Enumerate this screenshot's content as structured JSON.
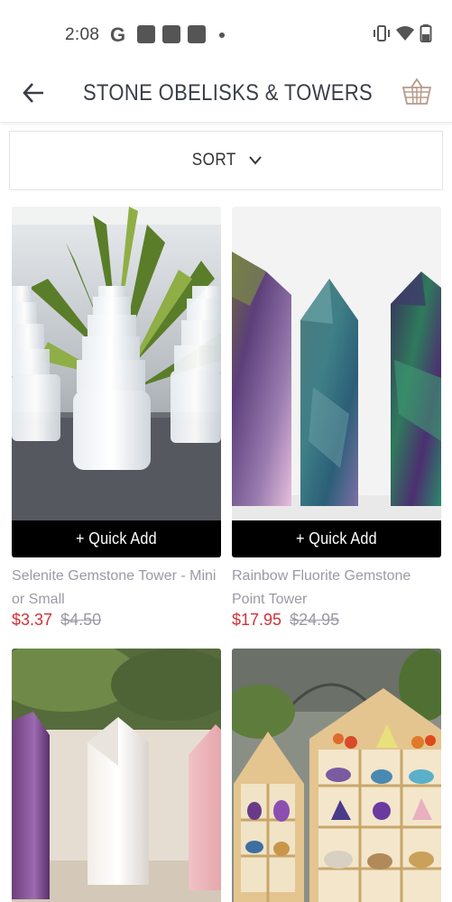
{
  "status_bar": {
    "time": "2:08",
    "g_letter": "G"
  },
  "header": {
    "title": "STONE OBELISKS & TOWERS"
  },
  "sort": {
    "label": "SORT"
  },
  "products": [
    {
      "name": "Selenite Gemstone Tower - Mini or Small",
      "sale_price": "$3.37",
      "original_price": "$4.50",
      "quick_add_label": "+ Quick Add"
    },
    {
      "name": "Rainbow Fluorite Gemstone Point Tower",
      "sale_price": "$17.95",
      "original_price": "$24.95",
      "quick_add_label": "+ Quick Add"
    }
  ],
  "colors": {
    "sale_price": "#d0323a",
    "original_price": "#9a9aa6",
    "quick_add_bg": "#000000",
    "title_text": "#3a3f47"
  }
}
